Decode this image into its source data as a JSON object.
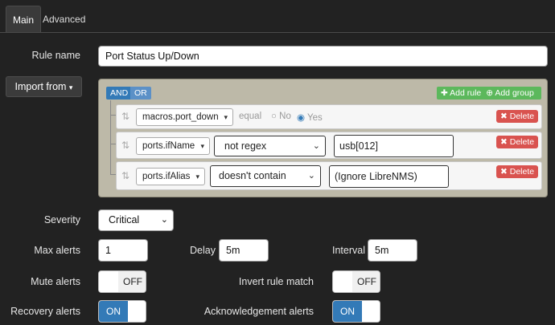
{
  "tabs": [
    {
      "label": "Main"
    },
    {
      "label": "Advanced"
    }
  ],
  "form": {
    "rule_name_label": "Rule name",
    "rule_name_value": "Port Status Up/Down",
    "import_label": "Import from",
    "import_caret": "▾"
  },
  "builder": {
    "and_label": "AND",
    "or_label": "OR",
    "add_rule_label": "Add rule",
    "add_group_label": "Add group",
    "delete_label": "Delete",
    "rules": [
      {
        "field": "macros.port_down",
        "operator": "equal",
        "opt_no": "No",
        "opt_yes": "Yes",
        "selected": "Yes"
      },
      {
        "field": "ports.ifName",
        "operator": "not regex",
        "value": "usb[012]"
      },
      {
        "field": "ports.ifAlias",
        "operator": "doesn't contain",
        "value": "(Ignore LibreNMS)"
      }
    ]
  },
  "settings": {
    "severity_label": "Severity",
    "severity_value": "Critical",
    "max_alerts_label": "Max alerts",
    "max_alerts_value": "1",
    "delay_label": "Delay",
    "delay_value": "5m",
    "interval_label": "Interval",
    "interval_value": "5m",
    "mute_label": "Mute alerts",
    "mute_state": "OFF",
    "invert_label": "Invert rule match",
    "invert_state": "OFF",
    "recovery_label": "Recovery alerts",
    "recovery_state": "ON",
    "ack_label": "Acknowledgement alerts",
    "ack_state": "ON"
  },
  "colors": {
    "accent": "#337ab7",
    "success": "#5cb85c",
    "danger": "#d9534f",
    "panel": "#bdb9a8"
  },
  "icons": [
    "sort-handle-icon",
    "plus-icon",
    "plus-circle-icon",
    "x-icon",
    "chevron-down-icon"
  ]
}
